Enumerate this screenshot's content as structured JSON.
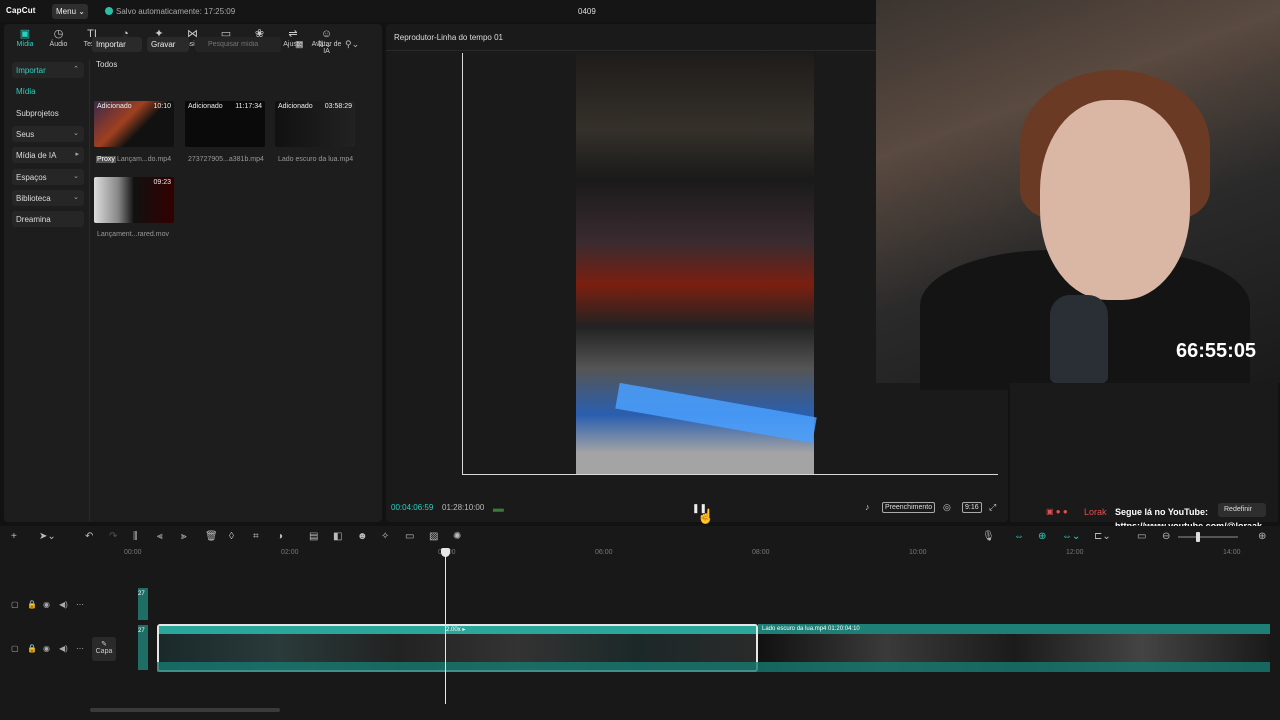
{
  "app": {
    "logo": "CapCut",
    "menu_label": "Menu ⌄",
    "autosave": "Salvo automaticamente: 17:25:09",
    "project_title": "0409"
  },
  "toolbar": [
    {
      "label": "Mídia",
      "icon": "media-icon",
      "glyph": "▣"
    },
    {
      "label": "Áudio",
      "icon": "audio-icon",
      "glyph": "◷"
    },
    {
      "label": "Texto",
      "icon": "text-icon",
      "glyph": "TI"
    },
    {
      "label": "Stickers",
      "icon": "sticker-icon",
      "glyph": "◔"
    },
    {
      "label": "Efeitos",
      "icon": "effects-icon",
      "glyph": "✦"
    },
    {
      "label": "Transições",
      "icon": "transitions-icon",
      "glyph": "⋈"
    },
    {
      "label": "Legendas",
      "icon": "captions-icon",
      "glyph": "▭"
    },
    {
      "label": "Filtros",
      "icon": "filters-icon",
      "glyph": "❀"
    },
    {
      "label": "Ajuste",
      "icon": "adjust-icon",
      "glyph": "⇌"
    },
    {
      "label": "Avatar de IA",
      "icon": "ai-avatar-icon",
      "glyph": "☺"
    }
  ],
  "categories": [
    {
      "label": "Importar",
      "chev": "⌃"
    },
    {
      "label": "Mídia",
      "chev": ""
    },
    {
      "label": "Subprojetos",
      "chev": ""
    },
    {
      "label": "Seus",
      "chev": "⌄"
    },
    {
      "label": "Mídia de IA",
      "chev": "▸"
    },
    {
      "label": "Espaços",
      "chev": "⌄"
    },
    {
      "label": "Biblioteca",
      "chev": "⌄"
    },
    {
      "label": "Dreamina",
      "chev": ""
    }
  ],
  "media": {
    "import_label": "Importar",
    "record_label": "Gravar",
    "search_placeholder": "Pesquisar mídia",
    "section": "Todos",
    "items": [
      {
        "tag": "Adicionado",
        "duration": "10:10",
        "name": "Lançam...do.mp4",
        "proxy": "Proxy"
      },
      {
        "tag": "Adicionado",
        "duration": "11:17:34",
        "name": "273727905...a381b.mp4",
        "proxy": ""
      },
      {
        "tag": "Adicionado",
        "duration": "03:58:29",
        "name": "Lado escuro da lua.mp4",
        "proxy": ""
      },
      {
        "tag": "",
        "duration": "09:23",
        "name": "Lançament...rared.mov",
        "proxy": ""
      }
    ]
  },
  "player": {
    "title": "Reprodutor-Linha do tempo 01",
    "current_time": "00:04:06:59",
    "total_time": "01:28:10:00",
    "pause_glyph": "❚❚",
    "fill_label": "Preenchimento",
    "ratio_label": "9:16"
  },
  "webcam": {
    "timer": "66:55:05",
    "name": "Lorak",
    "message": "Segue lá no YouTube:",
    "url": "https://www.youtube.com/@loraak",
    "reset_label": "Redefinir"
  },
  "timeline": {
    "ticks": [
      "00:00",
      "02:00",
      "04:00",
      "06:00",
      "08:00",
      "10:00",
      "12:00",
      "14:00"
    ],
    "speed_tag": "2.00x ▸",
    "clip2_label": "Lado escuro da lua.mp4   01:20:04:10",
    "capa_label": "Capa",
    "track_small_label": "27"
  },
  "colors": {
    "accent": "#2bd0c0",
    "clip_teal": "#1d7f76"
  }
}
